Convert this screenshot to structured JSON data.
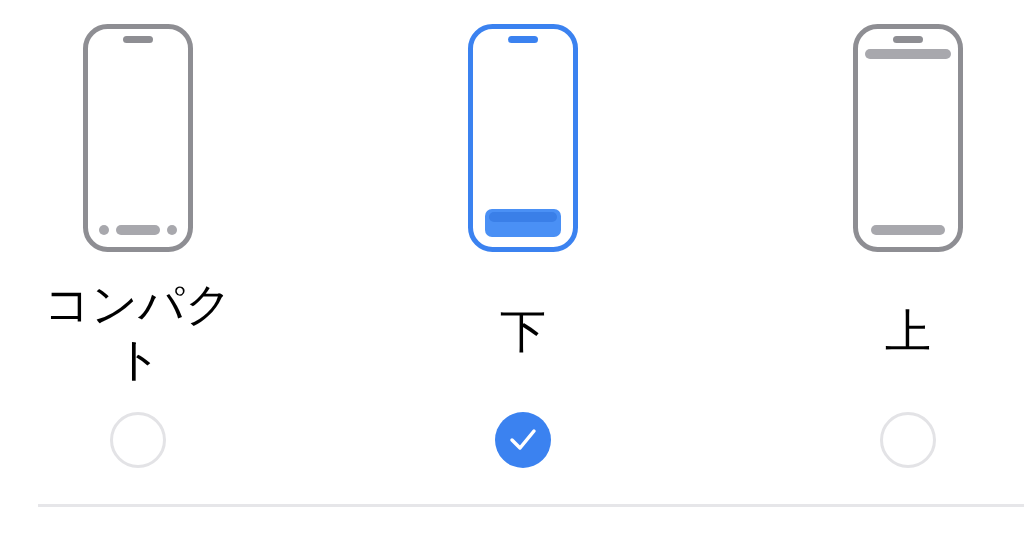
{
  "options": [
    {
      "kind": "compact",
      "label": "コンパクト",
      "selected": false
    },
    {
      "kind": "bottom",
      "label": "下",
      "selected": true
    },
    {
      "kind": "top",
      "label": "上",
      "selected": false
    }
  ]
}
